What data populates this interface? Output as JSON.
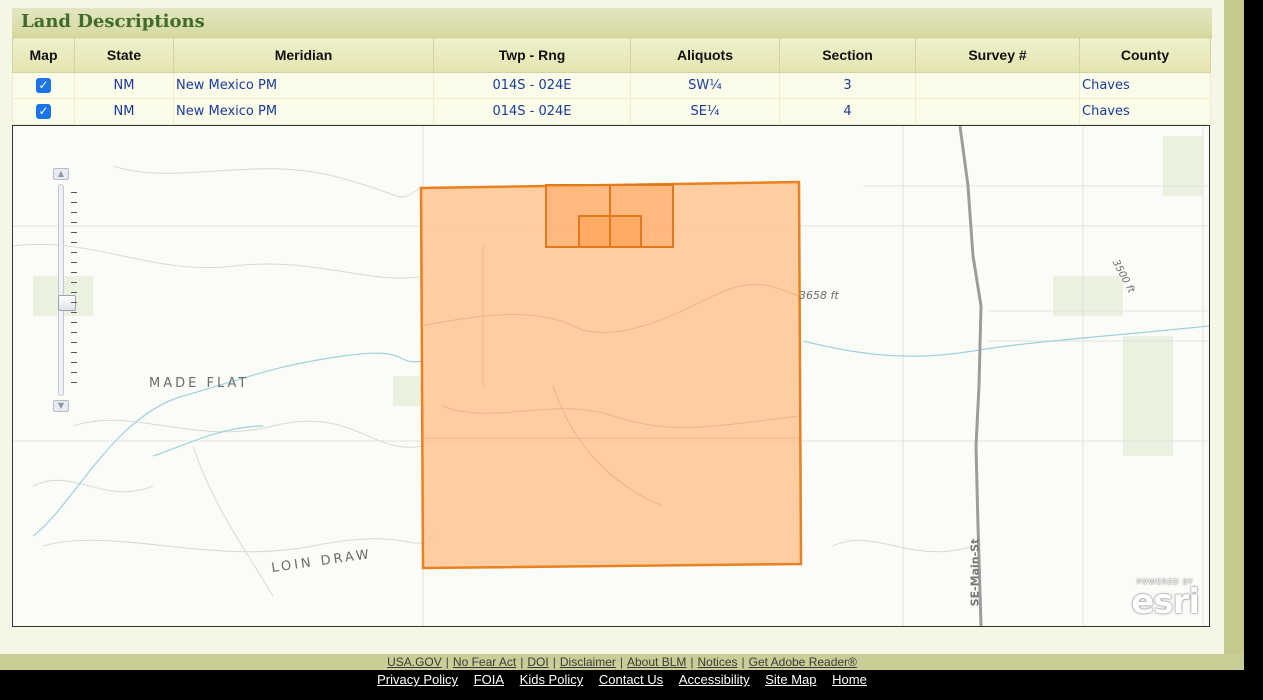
{
  "section": {
    "title": "Land Descriptions"
  },
  "table": {
    "headers": [
      "Map",
      "State",
      "Meridian",
      "Twp - Rng",
      "Aliquots",
      "Section",
      "Survey #",
      "County"
    ],
    "rows": [
      {
        "map_checked": true,
        "state": "NM",
        "meridian": "New Mexico PM",
        "twp_rng": "014S - 024E",
        "aliquots": "SW¼",
        "section": "3",
        "survey": "",
        "county": "Chaves"
      },
      {
        "map_checked": true,
        "state": "NM",
        "meridian": "New Mexico PM",
        "twp_rng": "014S - 024E",
        "aliquots": "SE¼",
        "section": "4",
        "survey": "",
        "county": "Chaves"
      }
    ]
  },
  "map": {
    "labels": {
      "made_flat": "MADE FLAT",
      "loin_draw": "LOIN DRAW",
      "elev_3658": "3658 ft",
      "elev_3500": "3500 ft",
      "road": "SE-Main-St"
    },
    "attribution": {
      "powered_by": "POWERED BY",
      "logo": "esri"
    },
    "polygon_fill": "#ffbd85",
    "polygon_stroke": "#e8811f"
  },
  "footer": {
    "row1": [
      "USA.GOV",
      "No Fear Act",
      "DOI",
      "Disclaimer",
      "About BLM",
      "Notices",
      "Get Adobe Reader®"
    ],
    "row2": [
      "Privacy Policy",
      "FOIA",
      "Kids Policy",
      "Contact Us",
      "Accessibility",
      "Site Map",
      "Home"
    ]
  }
}
